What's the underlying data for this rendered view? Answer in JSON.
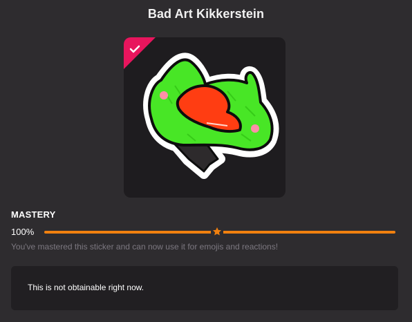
{
  "sticker": {
    "title": "Bad Art Kikkerstein",
    "image_icon": "frog-sticker-image",
    "mastered_badge_icon": "checkmark-icon"
  },
  "mastery": {
    "label": "MASTERY",
    "value_text": "100%",
    "progress_fraction": 1.0,
    "marker_icon": "star-icon",
    "description": "You've mastered this sticker and can now use it for emojis and reactions!"
  },
  "availability": {
    "message": "This is not obtainable right now."
  },
  "colors": {
    "background": "#2e2c2f",
    "card": "#1e1c1f",
    "accent": "#f0800f",
    "badge": "#e8155d",
    "frog_green": "#48e626",
    "mouth_red": "#ff3d12"
  }
}
